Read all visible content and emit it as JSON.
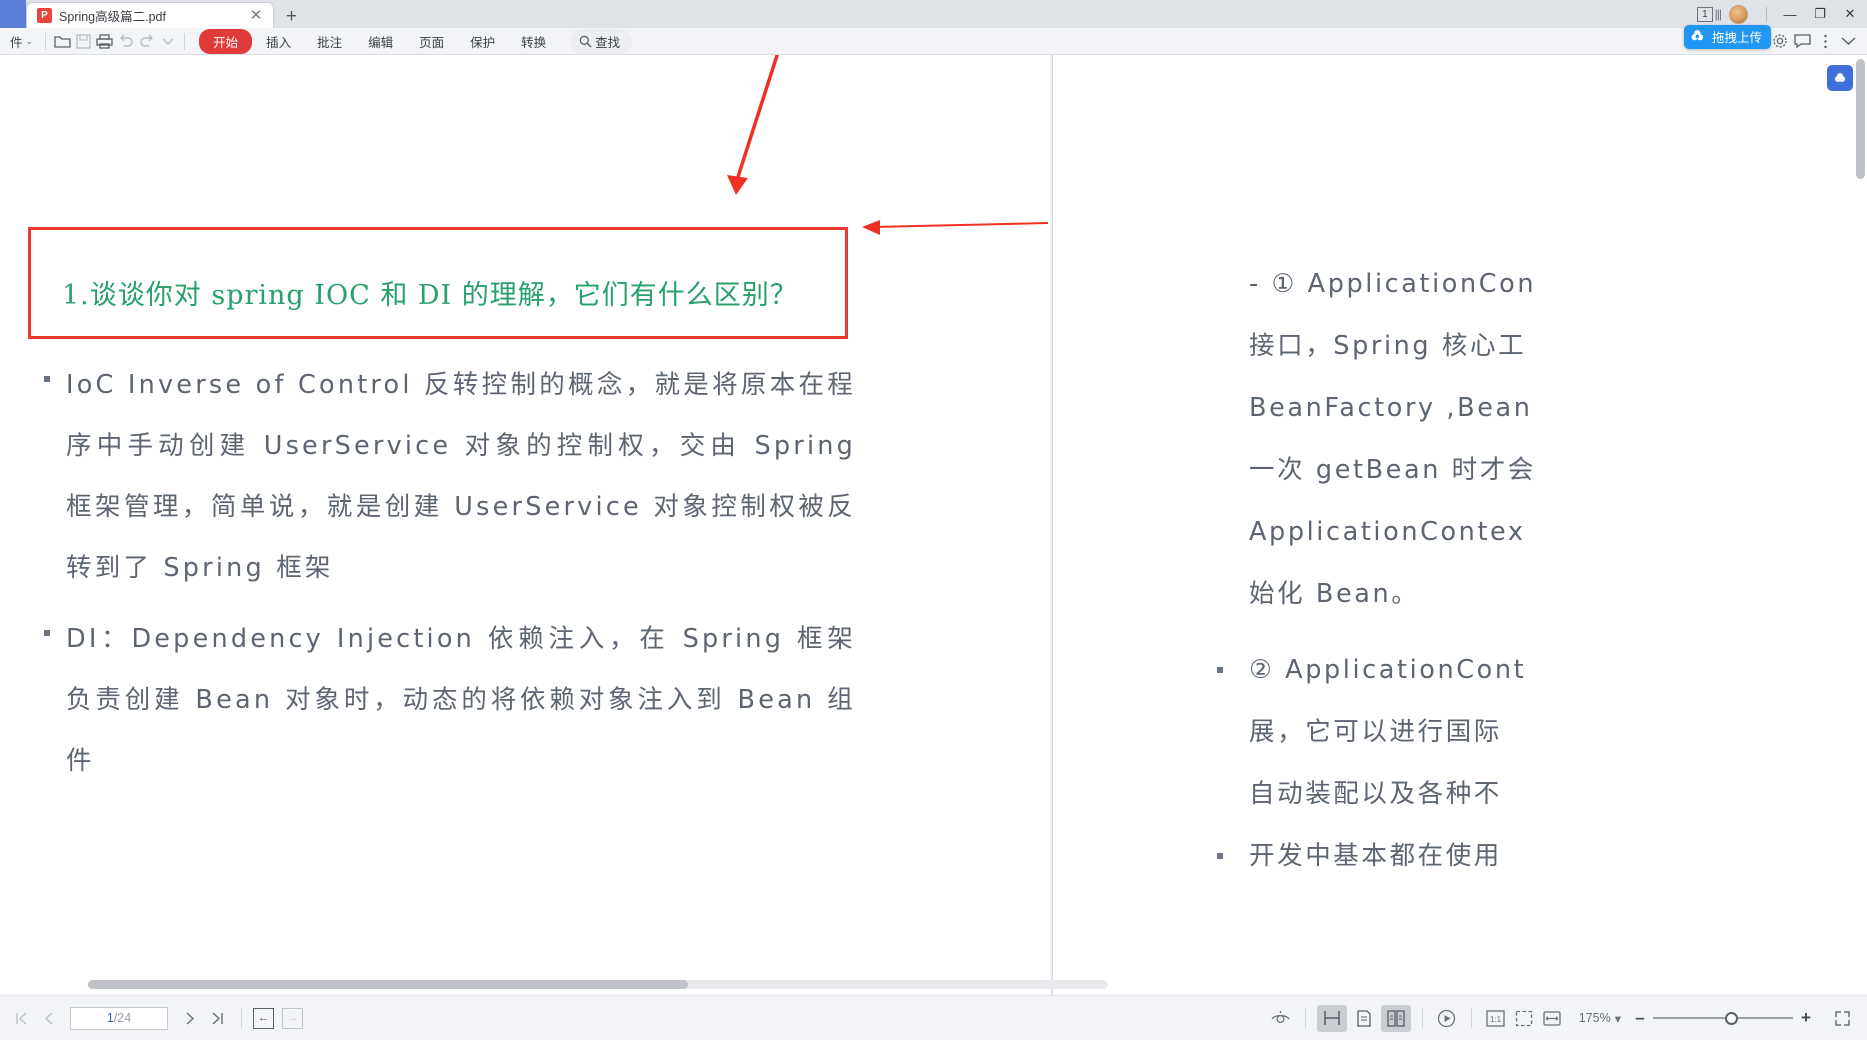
{
  "titlebar": {
    "tab": {
      "label": "Spring高级篇二.pdf",
      "badge": "P",
      "close": "✕"
    },
    "new_tab": "+",
    "page_chip": "1",
    "minimize": "—",
    "maximize": "❐",
    "close": "✕"
  },
  "menubar": {
    "file_label": "件",
    "file_caret": "⌄",
    "icons": {
      "open": "open-folder-icon",
      "save": "save-icon",
      "print": "print-icon",
      "undo": "undo-icon",
      "redo": "redo-icon",
      "more": "chevron-down-icon"
    },
    "items": [
      {
        "label": "开始",
        "active": true
      },
      {
        "label": "插入",
        "active": false
      },
      {
        "label": "批注",
        "active": false
      },
      {
        "label": "编辑",
        "active": false
      },
      {
        "label": "页面",
        "active": false
      },
      {
        "label": "保护",
        "active": false
      },
      {
        "label": "转换",
        "active": false
      }
    ],
    "search_label": "查找",
    "upload_chip": "拖拽上传",
    "right_icons": [
      "gear-icon",
      "comment-icon",
      "more-vertical-icon",
      "chevron-down-icon"
    ]
  },
  "document": {
    "heading": "1.谈谈你对 spring IOC 和 DI 的理解，它们有什么区别？",
    "heading_color": "#27a06a",
    "highlight_box_color": "#f0372b",
    "bullets": [
      "IoC Inverse of Control 反转控制的概念，就是将原本在程序中手动创建 UserService 对象的控制权，交由 Spring 框架管理，简单说，就是创建 UserService 对象控制权被反转到了 Spring 框架",
      "DI：Dependency  Injection  依赖注入，在 Spring 框架负责创建 Bean 对象时，动态的将依赖对象注入到 Bean 组件"
    ],
    "right_page": {
      "blocks": [
        {
          "marker": "",
          "lines": [
            "- ① ApplicationCon",
            "接口，Spring 核心工",
            "BeanFactory ,Bean",
            "一次 getBean 时才会",
            "ApplicationContex",
            "始化 Bean。"
          ]
        },
        {
          "marker": "bullet",
          "lines": [
            "② ApplicationCont",
            "展，它可以进行国际",
            "自动装配以及各种不",
            "开发中基本都在使用"
          ]
        }
      ]
    }
  },
  "statusbar": {
    "first_page": "first-page-icon",
    "prev_page": "prev-page-icon",
    "current_page": "1",
    "page_separator": "/",
    "total_pages": "24",
    "next_page": "next-page-icon",
    "last_page": "last-page-icon",
    "prev_view": "←",
    "next_view": "→",
    "eye_icon": "read-mode-icon",
    "view_modes": [
      {
        "name": "continuous-scroll",
        "selected": true
      },
      {
        "name": "single-page",
        "selected": false
      },
      {
        "name": "two-page-spread",
        "selected": true
      }
    ],
    "present_icon": "presentation-icon",
    "fit_actual": "1:1",
    "fit_page": "fit-page-icon",
    "fit_width": "fit-width-icon",
    "zoom_level": "175%",
    "zoom_caret": "▾",
    "zoom_out": "–",
    "zoom_in": "+",
    "fullscreen": "fullscreen-icon"
  }
}
